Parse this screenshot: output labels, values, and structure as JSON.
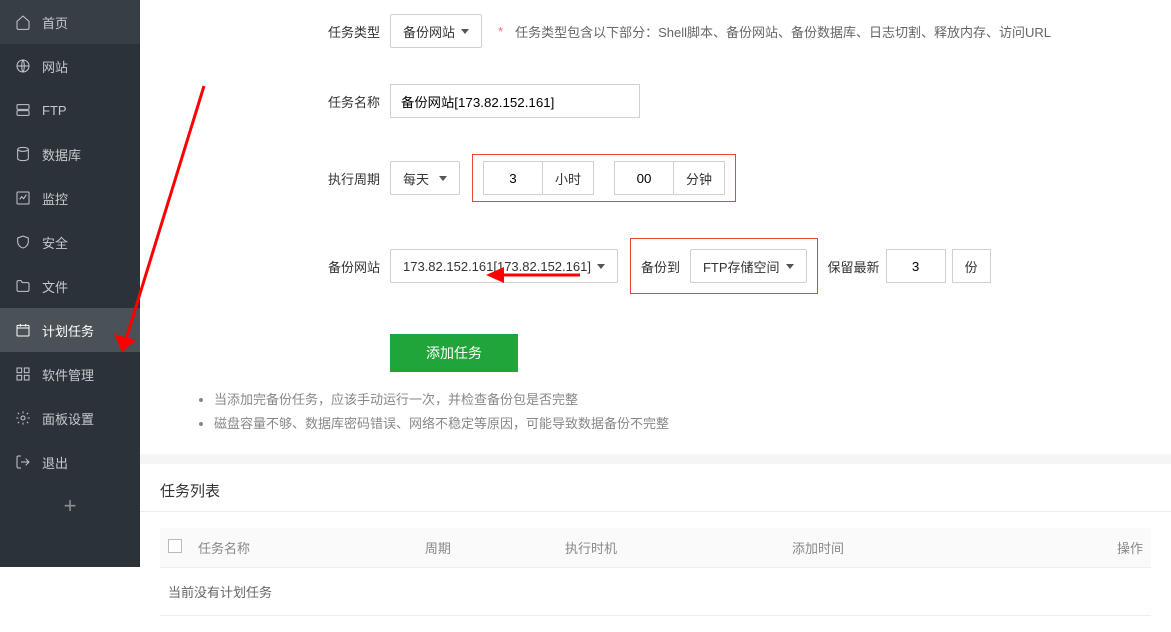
{
  "sidebar": {
    "items": [
      {
        "label": "首页",
        "id": "home"
      },
      {
        "label": "网站",
        "id": "website"
      },
      {
        "label": "FTP",
        "id": "ftp"
      },
      {
        "label": "数据库",
        "id": "database"
      },
      {
        "label": "监控",
        "id": "monitor"
      },
      {
        "label": "安全",
        "id": "security"
      },
      {
        "label": "文件",
        "id": "files"
      },
      {
        "label": "计划任务",
        "id": "cron",
        "active": true
      },
      {
        "label": "软件管理",
        "id": "software"
      },
      {
        "label": "面板设置",
        "id": "settings"
      },
      {
        "label": "退出",
        "id": "logout"
      }
    ],
    "add_label": "+"
  },
  "form": {
    "task_type_label": "任务类型",
    "task_type_value": "备份网站",
    "task_type_note": "任务类型包含以下部分：Shell脚本、备份网站、备份数据库、日志切割、释放内存、访问URL",
    "task_name_label": "任务名称",
    "task_name_value": "备份网站[173.82.152.161]",
    "cycle_label": "执行周期",
    "cycle_value": "每天",
    "hour_value": "3",
    "hour_unit": "小时",
    "minute_value": "00",
    "minute_unit": "分钟",
    "backup_site_label": "备份网站",
    "backup_site_value": "173.82.152.161[173.82.152.161]",
    "backup_to_label": "备份到",
    "backup_to_value": "FTP存储空间",
    "keep_latest_label": "保留最新",
    "keep_latest_value": "3",
    "keep_latest_unit": "份",
    "submit_label": "添加任务"
  },
  "hints": [
    "当添加完备份任务，应该手动运行一次，并检查备份包是否完整",
    "磁盘容量不够、数据库密码错误、网络不稳定等原因，可能导致数据备份不完整"
  ],
  "task_list": {
    "title": "任务列表",
    "columns": {
      "name": "任务名称",
      "cycle": "周期",
      "runtime": "执行时机",
      "added": "添加时间",
      "op": "操作"
    },
    "empty": "当前没有计划任务"
  }
}
